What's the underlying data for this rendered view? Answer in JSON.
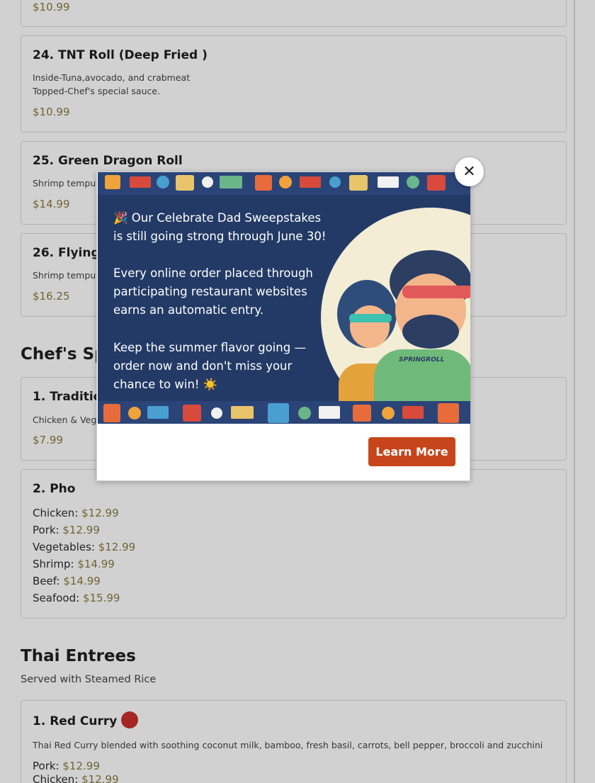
{
  "items_top": [
    {
      "price": "$10.99"
    },
    {
      "title": "24. TNT Roll (Deep Fried )",
      "desc_lines": [
        "Inside-Tuna,avocado, and crabmeat",
        "Topped-Chef's special sauce."
      ],
      "price": "$10.99"
    },
    {
      "title": "25. Green Dragon Roll",
      "desc": "Shrimp tempura",
      "price": "$14.99"
    },
    {
      "title": "26. Flying S",
      "desc": "Shrimp tempura",
      "price": "$16.25"
    }
  ],
  "chef_section": {
    "title": "Chef's Spe"
  },
  "chef_items": [
    {
      "title": "1. Traditio",
      "desc": "Chicken & Veg",
      "price": "$7.99"
    },
    {
      "title": "2. Pho",
      "prices": [
        {
          "label": "Chicken:",
          "value": "$12.99"
        },
        {
          "label": "Pork:",
          "value": "$12.99"
        },
        {
          "label": "Vegetables:",
          "value": "$12.99"
        },
        {
          "label": "Shrimp:",
          "value": "$14.99"
        },
        {
          "label": "Beef:",
          "value": "$14.99"
        },
        {
          "label": "Seafood:",
          "value": "$15.99"
        }
      ]
    }
  ],
  "thai_section": {
    "title": "Thai Entrees",
    "subtitle": "Served with Steamed Rice"
  },
  "thai_items": [
    {
      "title": "1. Red Curry",
      "icon": "spicy-icon",
      "desc": "Thai Red Curry blended with soothing coconut milk, bamboo, fresh basil, carrots, bell pepper, broccoli and zucchini",
      "prices": [
        {
          "label": "Pork:",
          "value": "$12.99"
        },
        {
          "label": "Chicken:",
          "value": "$12.99"
        }
      ]
    }
  ],
  "modal": {
    "close_icon": "close-icon",
    "promo_lines_1": [
      "🎉 Our Celebrate Dad Sweepstakes",
      "is still going strong through June 30!"
    ],
    "promo_lines_2": [
      "Every online order placed through",
      "participating restaurant websites",
      "earns an automatic entry."
    ],
    "promo_lines_3": [
      "Keep the summer flavor going —",
      "order now and don't miss your",
      "chance to win! ☀️"
    ],
    "brand_badge": "SPRINGROLL",
    "learn_more_label": "Learn More"
  },
  "colors": {
    "price": "#8a7a3e",
    "promo_bg": "#233a66",
    "button": "#c8451b"
  }
}
